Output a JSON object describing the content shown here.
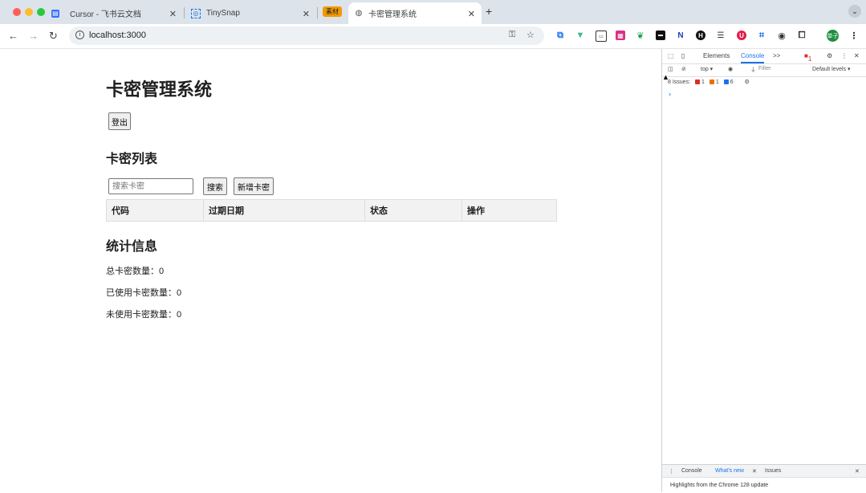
{
  "browser": {
    "tabs": [
      {
        "title": "Cursor - 飞书云文档",
        "icon": "doc-icon"
      },
      {
        "title": "TinySnap",
        "icon": "tinysnap-icon"
      },
      {
        "title": "卡密管理系统",
        "icon": "globe-icon"
      }
    ],
    "tab_group_label": "素材",
    "new_tab": "+",
    "address": "localhost:3000",
    "extensions": [
      "crop",
      "vue",
      "ext-box",
      "ext-pink",
      "ext-leaf",
      "ext-mini",
      "ext-n",
      "ext-h",
      "ext-sliders",
      "ext-red",
      "ext-grid",
      "ext-circle",
      "extensions"
    ],
    "profile": "单子"
  },
  "app": {
    "title": "卡密管理系统",
    "logout_label": "登出",
    "list_heading": "卡密列表",
    "search_placeholder": "搜索卡密",
    "search_button": "搜索",
    "add_button": "新增卡密",
    "table_headers": [
      "代码",
      "过期日期",
      "状态",
      "操作"
    ],
    "stats_heading": "统计信息",
    "stats": [
      {
        "label": "总卡密数量：",
        "value": "0"
      },
      {
        "label": "已使用卡密数量：",
        "value": "0"
      },
      {
        "label": "未使用卡密数量：",
        "value": "0"
      }
    ]
  },
  "devtools": {
    "tabs": [
      "Elements",
      "Console",
      ">>"
    ],
    "error_count": "1",
    "context": "top ▾",
    "filter_placeholder": "Filter",
    "levels": "Default levels ▾",
    "issues_label": "8 Issues:",
    "issues_counts": [
      "1",
      "1",
      "6"
    ],
    "prompt": "›",
    "drawer_tabs": [
      "Console",
      "What's new",
      "Issues"
    ],
    "drawer_message": "Highlights from the Chrome 128 update"
  },
  "colors": {
    "tabstrip": "#dde3ea",
    "accent": "#1a73e8",
    "group_tag": "#f29900"
  }
}
